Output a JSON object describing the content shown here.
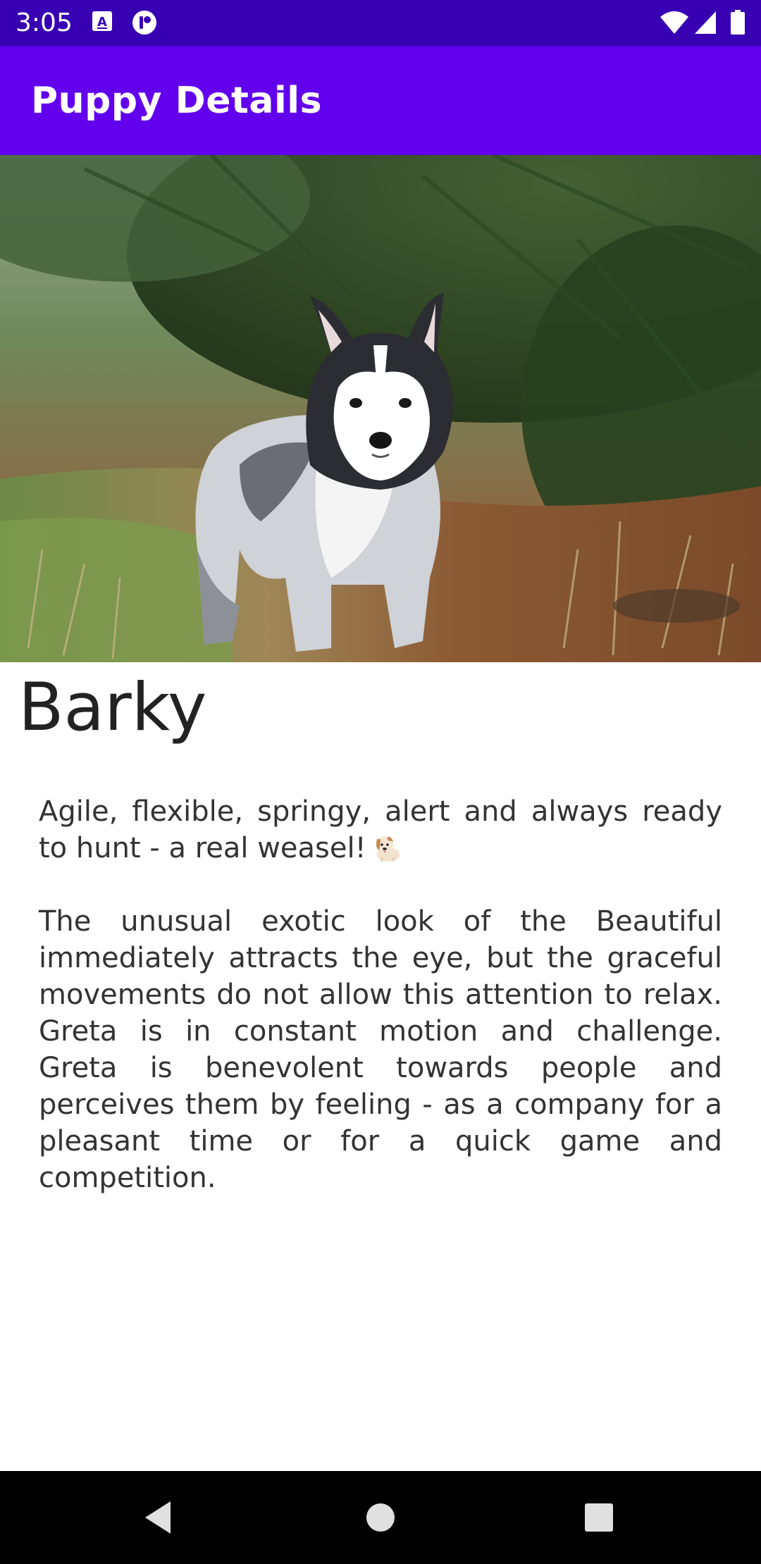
{
  "status_bar": {
    "time": "3:05",
    "left_icons": [
      "text-a-icon",
      "notification-app-icon"
    ],
    "right_icons": [
      "wifi-icon",
      "signal-icon",
      "battery-icon"
    ]
  },
  "app_bar": {
    "title": "Puppy Details"
  },
  "puppy": {
    "name": "Barky",
    "photo_subject": "husky-puppy-photo",
    "description_1": "Agile, flexible, springy, alert and always ready to hunt - a real weasel!",
    "description_2": "The unusual exotic look of the Beautiful immediately attracts the eye, but the graceful movements do not allow this attention to relax. Greta is in constant motion and challenge. Greta is benevolent towards people and perceives them by feeling - as a company for a pleasant time or for a quick game and competition."
  },
  "nav_bar": {
    "buttons": [
      "back-icon",
      "home-icon",
      "recents-icon"
    ]
  },
  "colors": {
    "status_bar": "#3700b3",
    "app_bar": "#6200ee",
    "nav_bar": "#000000",
    "background": "#ffffff"
  }
}
